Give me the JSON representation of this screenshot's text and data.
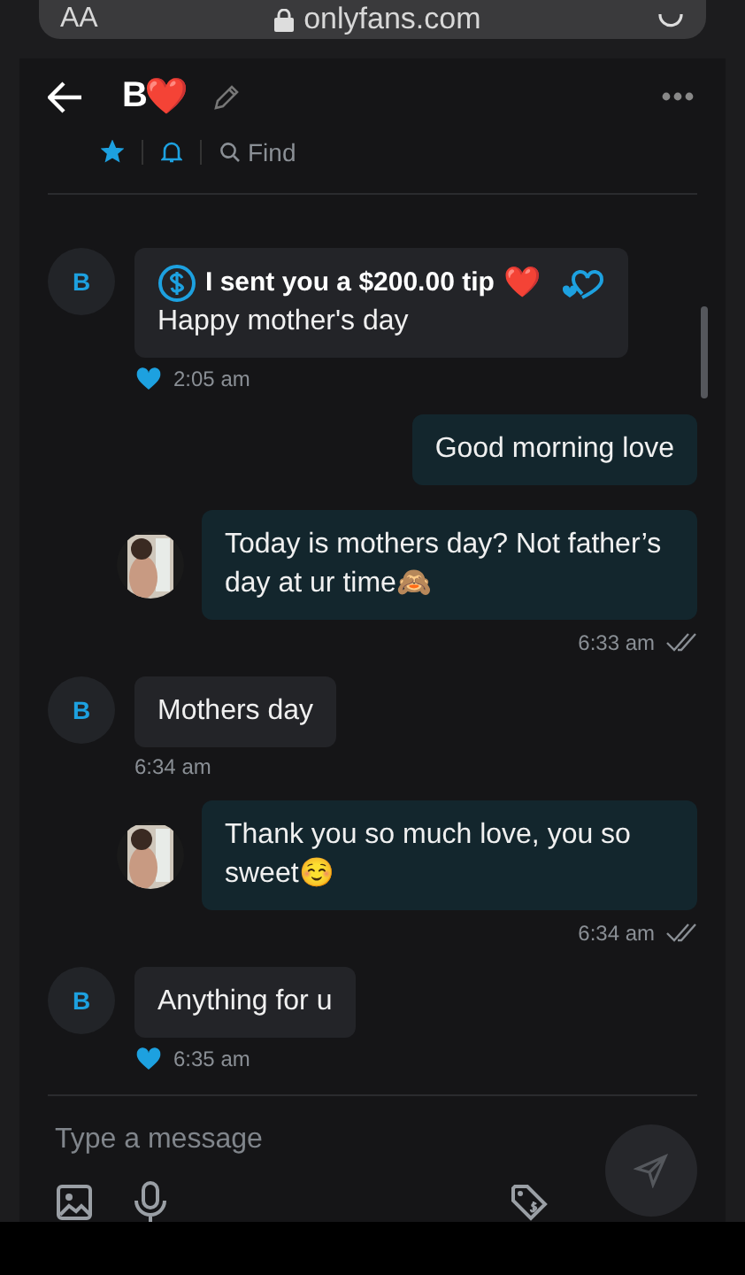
{
  "browser": {
    "text_size": "AA",
    "url": "onlyfans.com"
  },
  "chat": {
    "name": "B",
    "name_emoji": "❤️",
    "starred": true,
    "notifications": true,
    "find": "Find"
  },
  "messages": [
    {
      "kind": "incoming",
      "avatar": "B",
      "tip": "I sent you a $200.00 tip",
      "tip_emoji": "❤️",
      "text": "Happy mother's day",
      "liked": true,
      "time": "2:05 am"
    },
    {
      "kind": "outgoing",
      "show_avatar": false,
      "text": "Good morning love"
    },
    {
      "kind": "outgoing",
      "show_avatar": true,
      "text": "Today is mothers day? Not father’s day at ur time🙈",
      "time": "6:33 am",
      "read": true
    },
    {
      "kind": "incoming",
      "avatar": "B",
      "text": "Mothers day",
      "liked": false,
      "time": "6:34 am"
    },
    {
      "kind": "outgoing",
      "show_avatar": true,
      "text": "Thank you so much love, you so sweet☺️",
      "time": "6:34 am",
      "read": true
    },
    {
      "kind": "incoming",
      "avatar": "B",
      "text": "Anything for u",
      "liked": true,
      "time": "6:35 am"
    }
  ],
  "composer": {
    "placeholder": "Type a message"
  }
}
